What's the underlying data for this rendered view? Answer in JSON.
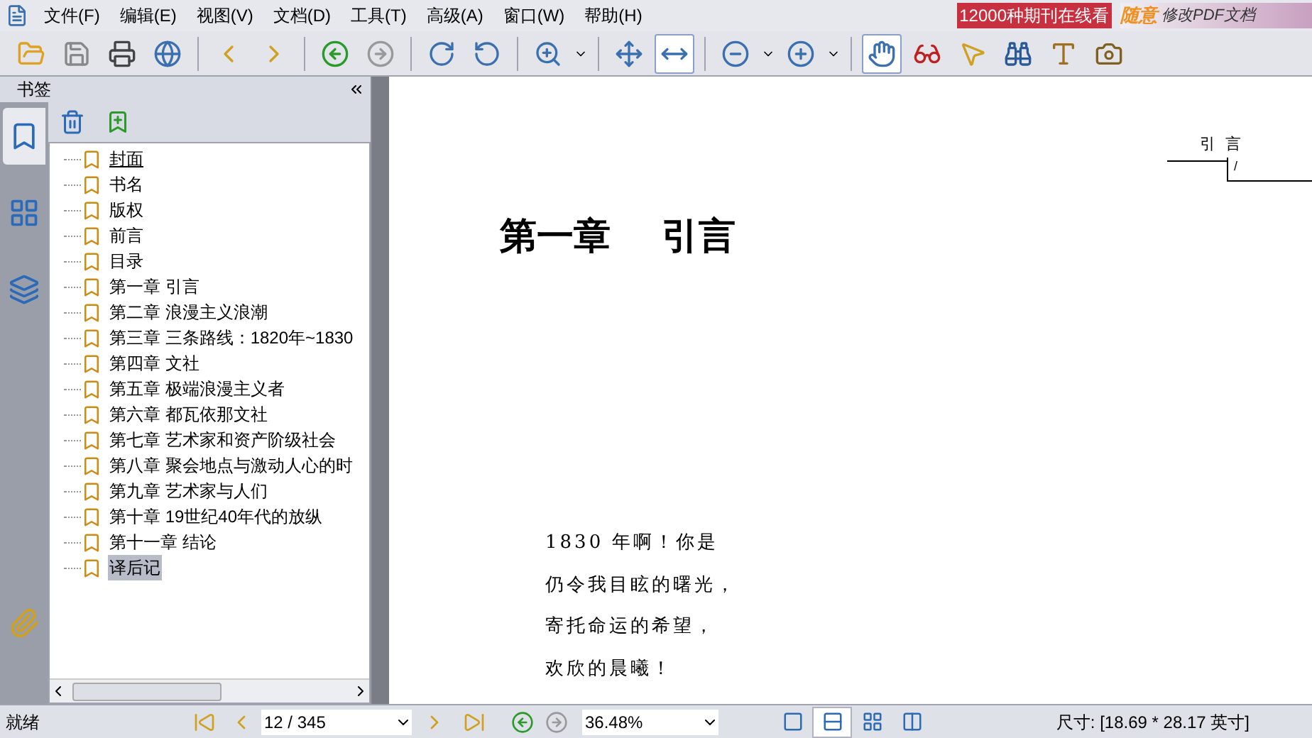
{
  "menu": [
    "文件(F)",
    "编辑(E)",
    "视图(V)",
    "文档(D)",
    "工具(T)",
    "高级(A)",
    "窗口(W)",
    "帮助(H)"
  ],
  "ads": {
    "promo": "12000种期刊在线看",
    "brand": "随意",
    "slogan": "修改PDF文档"
  },
  "toolbar": [
    {
      "kind": "folder",
      "selected": false
    },
    {
      "kind": "save",
      "selected": false
    },
    {
      "kind": "print",
      "selected": false
    },
    {
      "kind": "email",
      "selected": false
    },
    {
      "kind": "sep"
    },
    {
      "kind": "prev",
      "selected": false
    },
    {
      "kind": "next",
      "selected": false
    },
    {
      "kind": "sep"
    },
    {
      "kind": "back",
      "selected": false
    },
    {
      "kind": "forward",
      "selected": false
    },
    {
      "kind": "sep"
    },
    {
      "kind": "rotate-right",
      "selected": false
    },
    {
      "kind": "rotate-left",
      "selected": false
    },
    {
      "kind": "sep"
    },
    {
      "kind": "zoom-in",
      "selected": false
    },
    {
      "kind": "caret"
    },
    {
      "kind": "sep"
    },
    {
      "kind": "fit-page",
      "selected": false
    },
    {
      "kind": "fit-width",
      "selected": true
    },
    {
      "kind": "sep"
    },
    {
      "kind": "zoom-out-circle",
      "selected": false
    },
    {
      "kind": "caret"
    },
    {
      "kind": "zoom-in-circle",
      "selected": false
    },
    {
      "kind": "caret"
    },
    {
      "kind": "sep"
    },
    {
      "kind": "hand",
      "selected": true
    },
    {
      "kind": "glasses",
      "selected": false
    },
    {
      "kind": "pointer",
      "selected": false
    },
    {
      "kind": "binoculars",
      "selected": false
    },
    {
      "kind": "text",
      "selected": false
    },
    {
      "kind": "camera",
      "selected": false
    }
  ],
  "sidebar": {
    "title": "书签",
    "tabs": [
      {
        "kind": "bookmarks",
        "selected": true
      },
      {
        "kind": "thumbnails",
        "selected": false
      },
      {
        "kind": "layers",
        "selected": false
      }
    ],
    "items": [
      {
        "label": "封面",
        "selected": false,
        "hovered": true
      },
      {
        "label": "书名",
        "selected": false,
        "hovered": false
      },
      {
        "label": "版权",
        "selected": false,
        "hovered": false
      },
      {
        "label": "前言",
        "selected": false,
        "hovered": false
      },
      {
        "label": "目录",
        "selected": false,
        "hovered": false
      },
      {
        "label": "第一章  引言",
        "selected": false,
        "hovered": false
      },
      {
        "label": "第二章  浪漫主义浪潮",
        "selected": false,
        "hovered": false
      },
      {
        "label": "第三章  三条路线：1820年~1830",
        "selected": false,
        "hovered": false
      },
      {
        "label": "第四章  文社",
        "selected": false,
        "hovered": false
      },
      {
        "label": "第五章  极端浪漫主义者",
        "selected": false,
        "hovered": false
      },
      {
        "label": "第六章  都瓦依那文社",
        "selected": false,
        "hovered": false
      },
      {
        "label": "第七章  艺术家和资产阶级社会",
        "selected": false,
        "hovered": false
      },
      {
        "label": "第八章  聚会地点与激动人心的时",
        "selected": false,
        "hovered": false
      },
      {
        "label": "第九章  艺术家与人们",
        "selected": false,
        "hovered": false
      },
      {
        "label": "第十章  19世纪40年代的放纵",
        "selected": false,
        "hovered": false
      },
      {
        "label": "第十一章 结论",
        "selected": false,
        "hovered": false
      },
      {
        "label": "译后记",
        "selected": true,
        "hovered": false
      }
    ]
  },
  "page": {
    "running_head": "引  言",
    "page_mark": "/",
    "title": "第一章    引言",
    "poem": [
      "1830 年啊！你是",
      "仍令我目眩的曙光，",
      "寄托命运的希望，",
      "欢欣的晨曦！"
    ]
  },
  "status_bar": {
    "state": "就绪",
    "page": "12 / 345",
    "zoom": "36.48%",
    "views": [
      {
        "kind": "single",
        "selected": false
      },
      {
        "kind": "continuous",
        "selected": true
      },
      {
        "kind": "grid",
        "selected": false
      },
      {
        "kind": "facing",
        "selected": false
      }
    ],
    "size": "尺寸: [18.69 * 28.17 英寸]"
  }
}
